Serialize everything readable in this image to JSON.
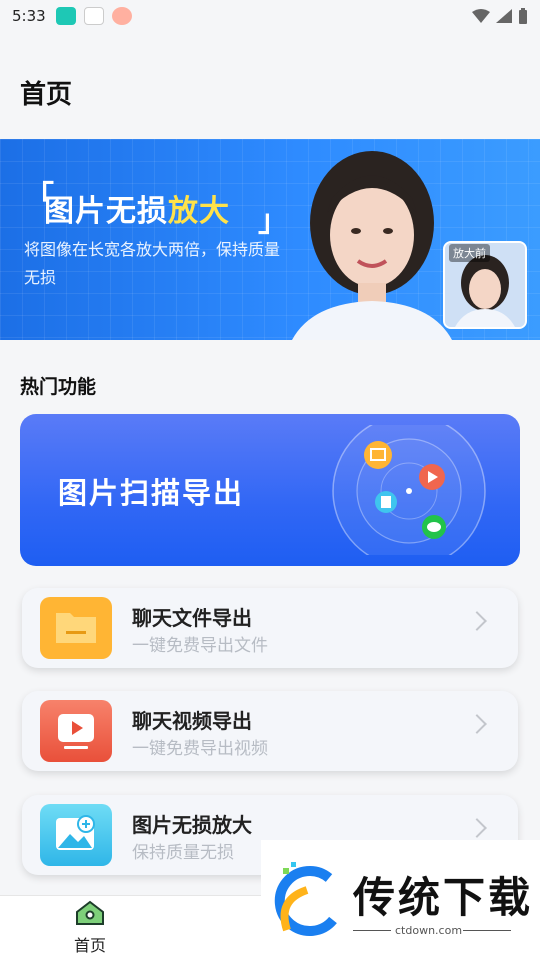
{
  "status_bar": {
    "time": "5:33"
  },
  "header": {
    "title": "首页"
  },
  "banner": {
    "title_prefix": "图片无损",
    "title_highlight": "放大",
    "subtitle": "将图像在长宽各放大两倍，保持质量无损",
    "thumb_label": "放大前"
  },
  "section": {
    "title": "热门功能"
  },
  "hot_card": {
    "title": "图片扫描导出"
  },
  "features": [
    {
      "title": "聊天文件导出",
      "subtitle": "一键免费导出文件",
      "icon": "folder-icon",
      "color": "#ffb534"
    },
    {
      "title": "聊天视频导出",
      "subtitle": "一键免费导出视频",
      "icon": "video-icon",
      "color": "#f0664e"
    },
    {
      "title": "图片无损放大",
      "subtitle": "保持质量无损",
      "icon": "image-zoom-icon",
      "color": "#3fc5ee"
    }
  ],
  "tabbar": {
    "home_label": "首页"
  },
  "watermark": {
    "brand": "传统下载",
    "url": "ctdown.com"
  }
}
